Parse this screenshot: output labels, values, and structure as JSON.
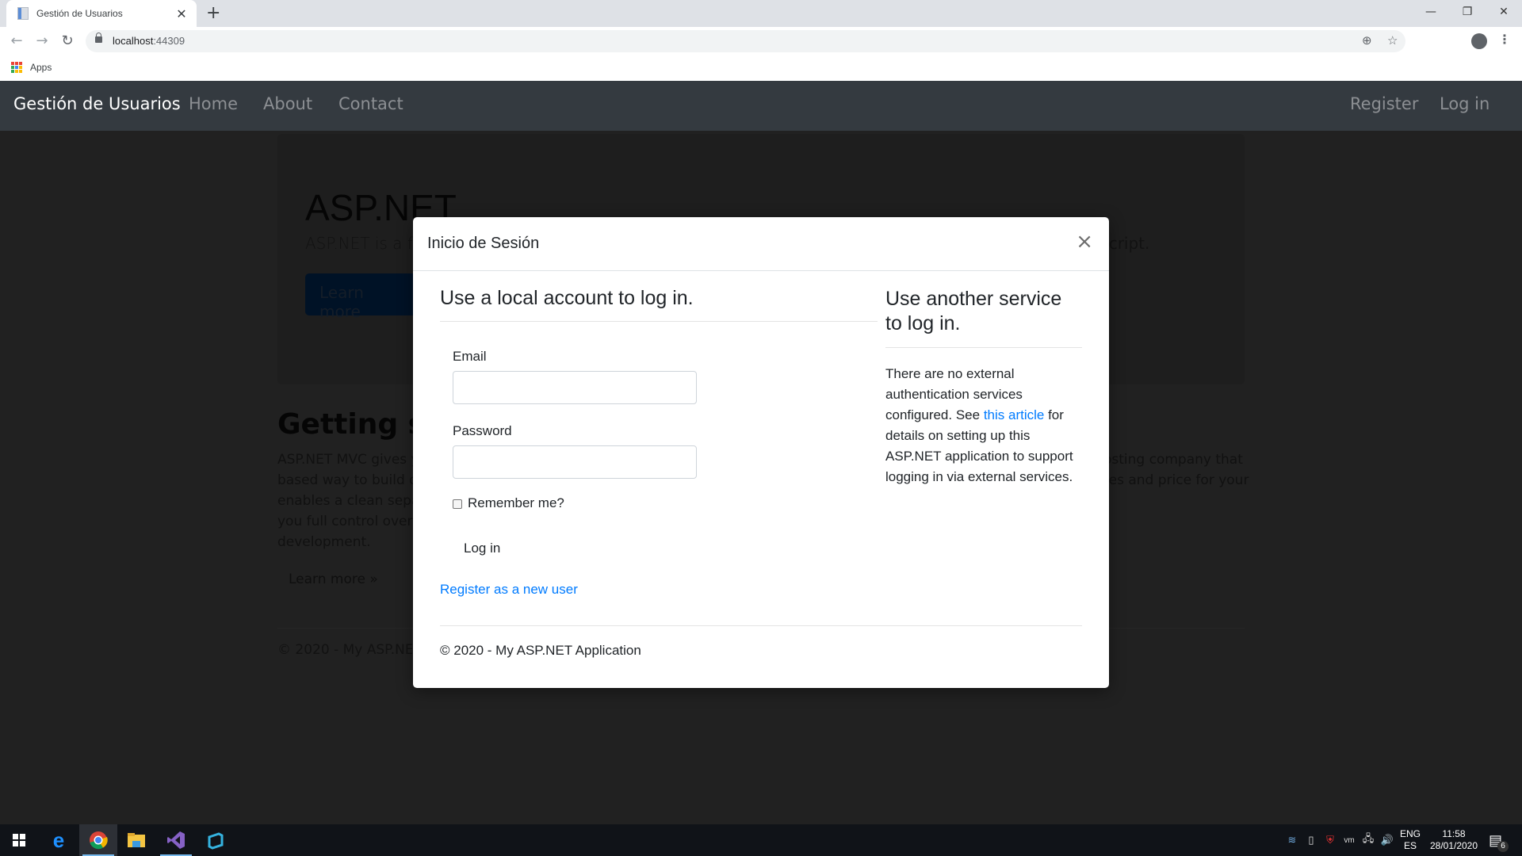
{
  "browser": {
    "tab_title": "Gestión de Usuarios",
    "url_host": "localhost",
    "url_port": ":44309",
    "bookmarks": [
      {
        "label": "Apps",
        "icon": "apps-grid-icon"
      }
    ],
    "icons": {
      "back": "arrow-left-icon",
      "forward": "arrow-right-icon",
      "reload": "reload-icon",
      "zoom": "zoom-icon",
      "star": "star-icon",
      "profile": "profile-icon",
      "menu": "menu-dots-icon"
    }
  },
  "navbar": {
    "brand": "Gestión de Usuarios",
    "links": [
      "Home",
      "About",
      "Contact"
    ],
    "right_links": [
      "Register",
      "Log in"
    ]
  },
  "background_page": {
    "jumbotron_title": "ASP.NET",
    "jumbotron_lead_start": "ASP.NET is a fre",
    "jumbotron_lead_end": "Script.",
    "jumbotron_button": "Learn more",
    "section_title": "Getting sta",
    "section_text_left": [
      "ASP.NET MVC gives yo",
      "based way to build dy",
      "enables a clean separa",
      "you full control over m",
      "development."
    ],
    "section_text_right": [
      "osting company that",
      "res and price for your"
    ],
    "learn_more": "Learn more »",
    "footer": "© 2020 - My ASP.NET"
  },
  "modal": {
    "title": "Inicio de Sesión",
    "close_label": "×",
    "local": {
      "heading": "Use a local account to log in.",
      "email_label": "Email",
      "email_value": "",
      "password_label": "Password",
      "password_value": "",
      "remember_label": "Remember me?",
      "remember_checked": false,
      "login_button": "Log in",
      "register_link": "Register as a new user"
    },
    "external": {
      "heading": "Use another service to log in.",
      "text_before": "There are no external authentication services configured. See ",
      "link": "this article",
      "text_after": " for details on setting up this ASP.NET application to support logging in via external services."
    },
    "footer": "© 2020 - My ASP.NET Application"
  },
  "taskbar": {
    "apps": [
      "Start",
      "Microsoft Edge",
      "Google Chrome",
      "File Explorer",
      "Visual Studio",
      "Azure Data Studio"
    ],
    "language_top": "ENG",
    "language_bottom": "ES",
    "time": "11:58",
    "date": "28/01/2020",
    "notification_count": "6"
  },
  "colors": {
    "navbar_bg": "#343a40",
    "link": "#007bff",
    "backdrop": "#212121"
  }
}
